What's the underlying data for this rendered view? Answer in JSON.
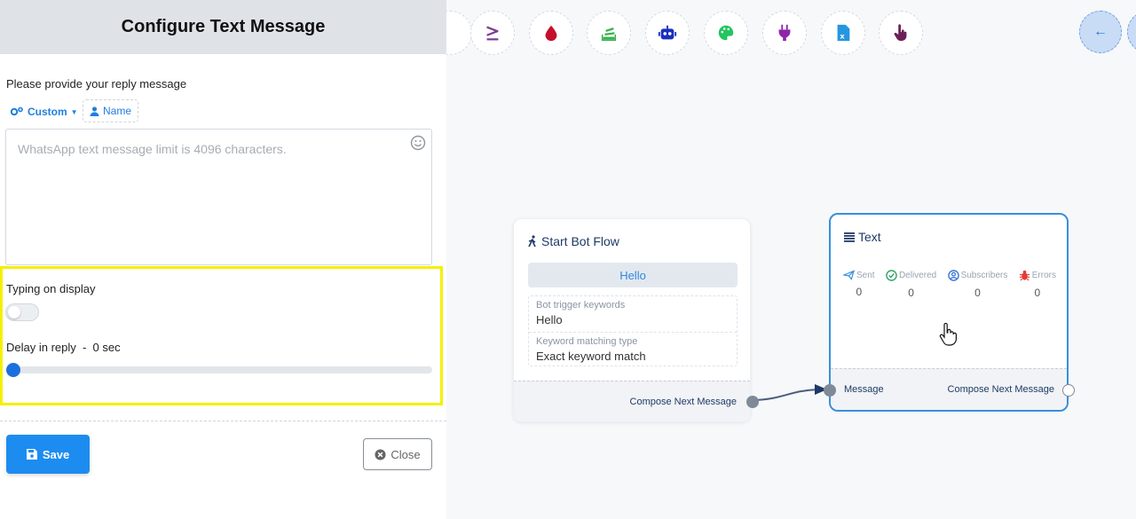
{
  "panel": {
    "title": "Configure Text Message",
    "prompt": "Please provide your reply message",
    "custom_label": "Custom",
    "name_label": "Name",
    "message_placeholder": "WhatsApp text message limit is 4096 characters.",
    "message_value": "",
    "typing_label": "Typing on display",
    "typing_enabled": false,
    "delay_label": "Delay in reply  -  0 sec",
    "delay_value_sec": 0,
    "save_label": "Save",
    "close_label": "Close"
  },
  "toolbar": {
    "icons": [
      "compare-icon",
      "drop-icon",
      "stack-icon",
      "robot-icon",
      "palette-icon",
      "plug-icon",
      "excel-file-icon",
      "pointer-hand-icon"
    ],
    "colors": {
      "compare": "#7d3c8f",
      "drop": "#c4102b",
      "stack": "#37b24d",
      "robot": "#1a2fbe",
      "palette": "#22c55e",
      "plug": "#8e24aa",
      "excel": "#2596e0",
      "hand": "#6d1f57"
    }
  },
  "start_node": {
    "title": "Start Bot Flow",
    "keyword_pill": "Hello",
    "trigger_label": "Bot trigger keywords",
    "trigger_value": "Hello",
    "match_label": "Keyword matching type",
    "match_value": "Exact keyword match",
    "footer_label": "Compose Next Message"
  },
  "text_node": {
    "title": "Text",
    "stats": [
      {
        "label": "Sent",
        "value": "0",
        "icon": "paper-plane-icon",
        "color": "#3a8fdd"
      },
      {
        "label": "Delivered",
        "value": "0",
        "icon": "check-circle-icon",
        "color": "#22a05a"
      },
      {
        "label": "Subscribers",
        "value": "0",
        "icon": "user-circle-icon",
        "color": "#2f6fd6"
      },
      {
        "label": "Errors",
        "value": "0",
        "icon": "bug-icon",
        "color": "#e53935"
      }
    ],
    "input_label": "Message",
    "output_label": "Compose Next Message"
  },
  "colors": {
    "accent": "#1d8cf0",
    "highlight": "#f4f000",
    "node_border": "#3a8fdd"
  }
}
